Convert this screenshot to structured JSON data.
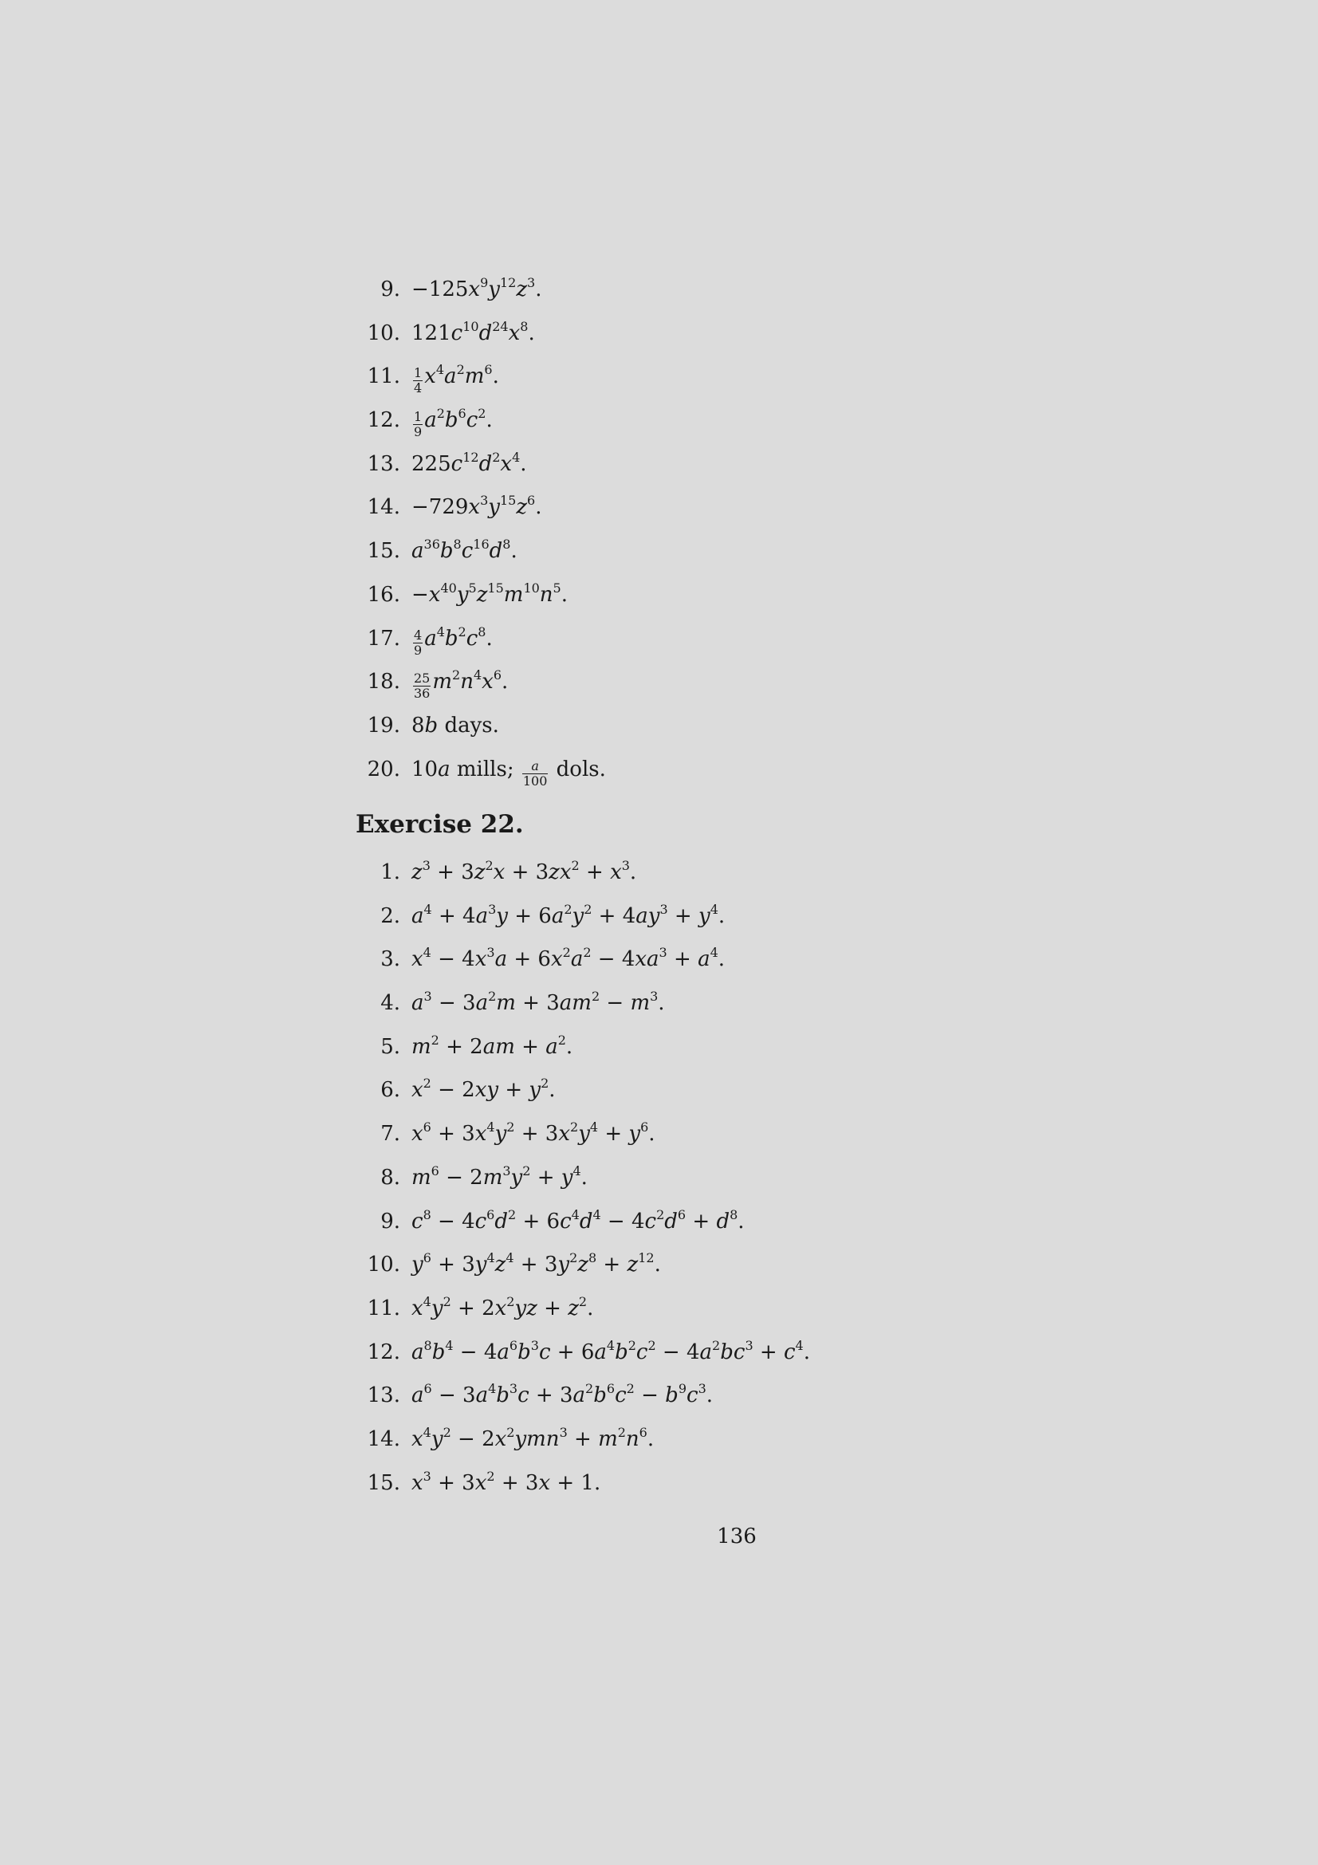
{
  "section_a": {
    "items": [
      {
        "num": "9.",
        "text": "−125x⁹y¹²z³."
      },
      {
        "num": "10.",
        "text": "121c¹⁰d²⁴x⁸."
      },
      {
        "num": "11.",
        "text": "¼x⁴a²m⁶."
      },
      {
        "num": "12.",
        "text": "⅑a²b⁶c²."
      },
      {
        "num": "13.",
        "text": "225c¹²d²x⁴."
      },
      {
        "num": "14.",
        "text": "−729x³y¹⁵z⁶."
      },
      {
        "num": "15.",
        "text": "a³⁶b⁸c¹⁶d⁸."
      },
      {
        "num": "16.",
        "text": "−x⁴⁰y⁵z¹⁵m¹⁰n⁵."
      },
      {
        "num": "17.",
        "text": "4/9 a⁴b²c⁸."
      },
      {
        "num": "18.",
        "text": "25/36 m²n⁴x⁶."
      },
      {
        "num": "19.",
        "text": "8b days."
      },
      {
        "num": "20.",
        "text": "10a mills; a/100 dols."
      }
    ]
  },
  "heading": "Exercise 22.",
  "section_b": {
    "items": [
      {
        "num": "1.",
        "text": "z³ + 3z²x + 3zx² + x³."
      },
      {
        "num": "2.",
        "text": "a⁴ + 4a³y + 6a²y² + 4ay³ + y⁴."
      },
      {
        "num": "3.",
        "text": "x⁴ − 4x³a + 6x²a² − 4xa³ + a⁴."
      },
      {
        "num": "4.",
        "text": "a³ − 3a²m + 3am² − m³."
      },
      {
        "num": "5.",
        "text": "m² + 2am + a²."
      },
      {
        "num": "6.",
        "text": "x² − 2xy + y²."
      },
      {
        "num": "7.",
        "text": "x⁶ + 3x⁴y² + 3x²y⁴ + y⁶."
      },
      {
        "num": "8.",
        "text": "m⁶ − 2m³y² + y⁴."
      },
      {
        "num": "9.",
        "text": "c⁸ − 4c⁶d² + 6c⁴d⁴ − 4c²d⁶ + d⁸."
      },
      {
        "num": "10.",
        "text": "y⁶ + 3y⁴z⁴ + 3y²z⁸ + z¹²."
      },
      {
        "num": "11.",
        "text": "x⁴y² + 2x²yz + z²."
      },
      {
        "num": "12.",
        "text": "a⁸b⁴ − 4a⁶b³c + 6a⁴b²c² − 4a²bc³ + c⁴."
      },
      {
        "num": "13.",
        "text": "a⁶ − 3a⁴b³c + 3a²b⁶c² − b⁹c³."
      },
      {
        "num": "14.",
        "text": "x⁴y² − 2x²ymn³ + m²n⁶."
      },
      {
        "num": "15.",
        "text": "x³ + 3x² + 3x + 1."
      }
    ]
  },
  "page_number": "136"
}
